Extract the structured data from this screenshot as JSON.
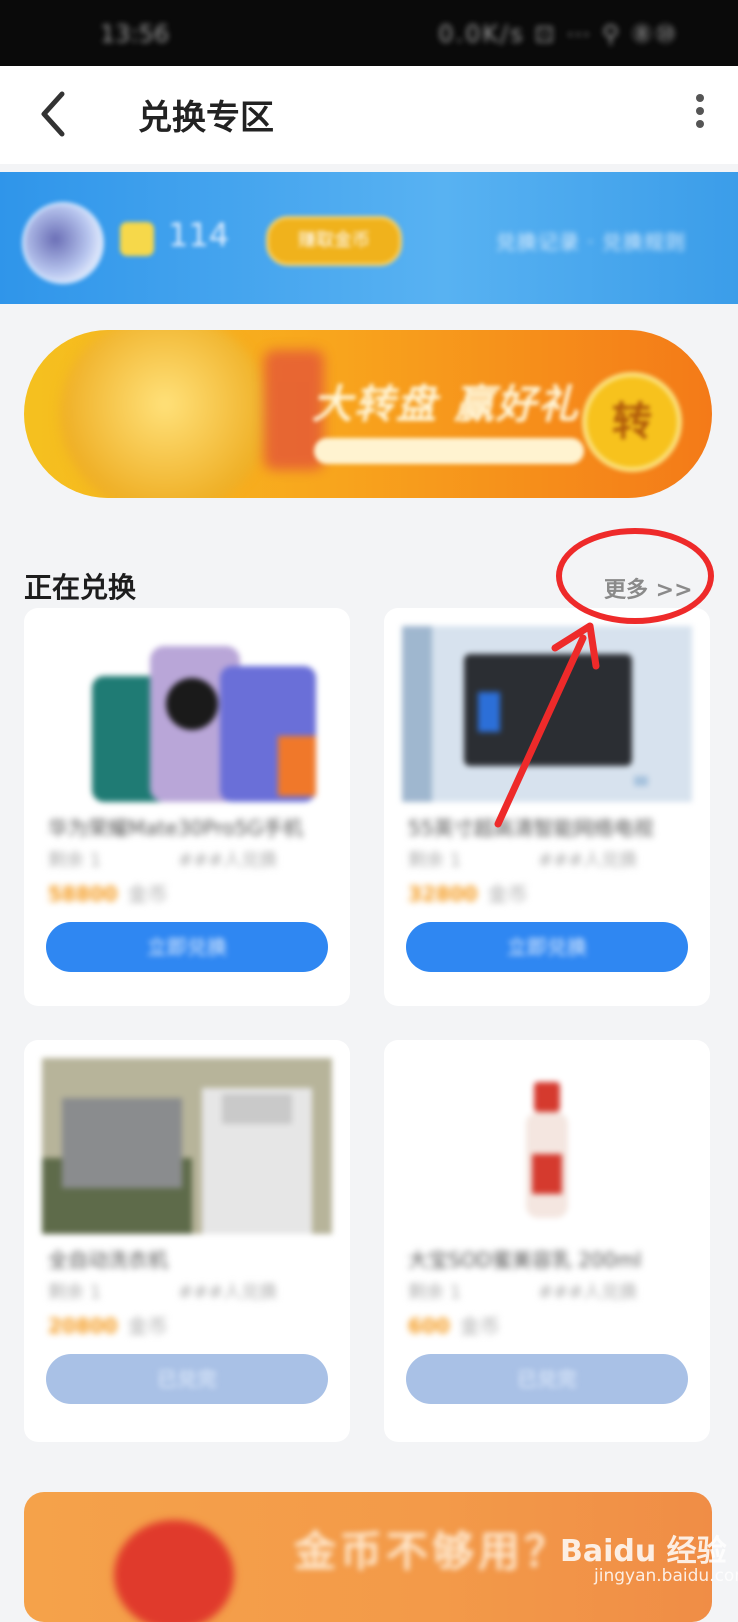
{
  "status_bar": {
    "time": "13:56",
    "indicators": "0.0K/s ⊡ ⋯ ⚲ ⑧⑩"
  },
  "header": {
    "title": "兑换专区",
    "back_icon": "chevron-left-icon",
    "menu_icon": "more-vertical-icon"
  },
  "user_bar": {
    "coin_count": "114",
    "pill_label": "赚取金币",
    "links": "兑换记录 · 兑换规则"
  },
  "banner": {
    "headline": "大转盘 赢好礼",
    "badge_text": "转"
  },
  "section": {
    "title": "正在兑换",
    "more_label": "更多 >>"
  },
  "products": [
    {
      "name": "华为荣耀Mate30Pro5G手机",
      "stock": "剩余 1",
      "exchanged": "###人兑换",
      "price": "58800",
      "unit": "金币",
      "button": "立即兑换"
    },
    {
      "name": "55英寸超高清智能网络电视",
      "stock": "剩余 1",
      "exchanged": "###人兑换",
      "price": "32800",
      "unit": "金币",
      "button": "立即兑换"
    },
    {
      "name": "全自动洗衣机",
      "stock": "剩余 1",
      "exchanged": "###人兑换",
      "price": "20800",
      "unit": "金币",
      "button": "已兑完"
    },
    {
      "name": "大宝SOD蜜美容乳 200ml",
      "stock": "剩余 1",
      "exchanged": "###人兑换",
      "price": "600",
      "unit": "金币",
      "button": "已兑完"
    }
  ],
  "bottom_banner": {
    "text": "金币不够用？"
  },
  "watermark": {
    "brand": "Baidu 经验",
    "url": "jingyan.baidu.com"
  },
  "colors": {
    "primary_blue": "#2f87f2",
    "disabled_blue": "#a9c1e6",
    "annotation_red": "#ee2a2a",
    "coin_orange": "#f49a1e"
  }
}
